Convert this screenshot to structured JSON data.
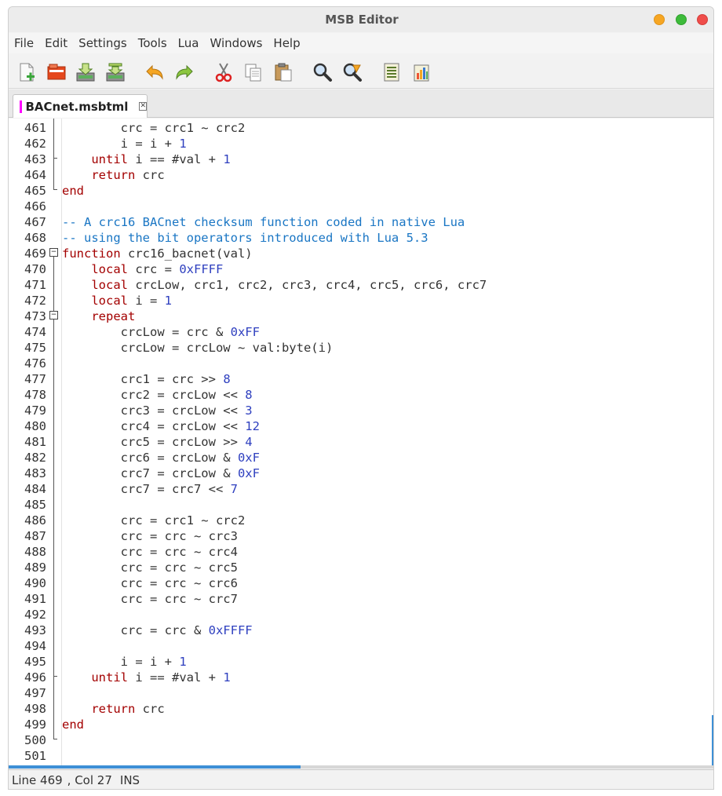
{
  "window": {
    "title": "MSB Editor"
  },
  "menu": {
    "items": [
      "File",
      "Edit",
      "Settings",
      "Tools",
      "Lua",
      "Windows",
      "Help"
    ]
  },
  "toolbar": {
    "icons": [
      "new-file-icon",
      "open-file-icon",
      "save-icon",
      "save-as-icon",
      "undo-icon",
      "redo-icon",
      "cut-icon",
      "copy-icon",
      "paste-icon",
      "find-icon",
      "replace-icon",
      "list-icon",
      "run-icon"
    ]
  },
  "tab": {
    "label": "BACnet.msbtml",
    "color": "#ff00ff"
  },
  "colors": {
    "keyword": "#a30000",
    "number": "#2e3fbf",
    "comment": "#1a76c4",
    "accent": "#3d8fd6"
  },
  "code": [
    {
      "num": "461",
      "t": [
        [
          "p",
          "        crc = crc1 ~ crc2"
        ]
      ]
    },
    {
      "num": "462",
      "t": [
        [
          "p",
          "        i = i + "
        ],
        [
          "n",
          "1"
        ]
      ]
    },
    {
      "num": "463",
      "t": [
        [
          "p",
          "    "
        ],
        [
          "k",
          "until"
        ],
        [
          "p",
          " i == #val + "
        ],
        [
          "n",
          "1"
        ]
      ]
    },
    {
      "num": "464",
      "t": [
        [
          "p",
          "    "
        ],
        [
          "k",
          "return"
        ],
        [
          "p",
          " crc"
        ]
      ]
    },
    {
      "num": "465",
      "t": [
        [
          "k",
          "end"
        ]
      ]
    },
    {
      "num": "466",
      "t": []
    },
    {
      "num": "467",
      "t": [
        [
          "c",
          "-- A crc16 BACnet checksum function coded in native Lua"
        ]
      ]
    },
    {
      "num": "468",
      "t": [
        [
          "c",
          "-- using the bit operators introduced with Lua 5.3"
        ]
      ]
    },
    {
      "num": "469",
      "t": [
        [
          "k",
          "function"
        ],
        [
          "p",
          " crc16_bacnet(val)"
        ]
      ]
    },
    {
      "num": "470",
      "t": [
        [
          "p",
          "    "
        ],
        [
          "k",
          "local"
        ],
        [
          "p",
          " crc = "
        ],
        [
          "n",
          "0xFFFF"
        ]
      ]
    },
    {
      "num": "471",
      "t": [
        [
          "p",
          "    "
        ],
        [
          "k",
          "local"
        ],
        [
          "p",
          " crcLow, crc1, crc2, crc3, crc4, crc5, crc6, crc7"
        ]
      ]
    },
    {
      "num": "472",
      "t": [
        [
          "p",
          "    "
        ],
        [
          "k",
          "local"
        ],
        [
          "p",
          " i = "
        ],
        [
          "n",
          "1"
        ]
      ]
    },
    {
      "num": "473",
      "t": [
        [
          "p",
          "    "
        ],
        [
          "k",
          "repeat"
        ]
      ]
    },
    {
      "num": "474",
      "t": [
        [
          "p",
          "        crcLow = crc & "
        ],
        [
          "n",
          "0xFF"
        ]
      ]
    },
    {
      "num": "475",
      "t": [
        [
          "p",
          "        crcLow = crcLow ~ val:byte(i)"
        ]
      ]
    },
    {
      "num": "476",
      "t": []
    },
    {
      "num": "477",
      "t": [
        [
          "p",
          "        crc1 = crc >> "
        ],
        [
          "n",
          "8"
        ]
      ]
    },
    {
      "num": "478",
      "t": [
        [
          "p",
          "        crc2 = crcLow << "
        ],
        [
          "n",
          "8"
        ]
      ]
    },
    {
      "num": "479",
      "t": [
        [
          "p",
          "        crc3 = crcLow << "
        ],
        [
          "n",
          "3"
        ]
      ]
    },
    {
      "num": "480",
      "t": [
        [
          "p",
          "        crc4 = crcLow << "
        ],
        [
          "n",
          "12"
        ]
      ]
    },
    {
      "num": "481",
      "t": [
        [
          "p",
          "        crc5 = crcLow >> "
        ],
        [
          "n",
          "4"
        ]
      ]
    },
    {
      "num": "482",
      "t": [
        [
          "p",
          "        crc6 = crcLow & "
        ],
        [
          "n",
          "0xF"
        ]
      ]
    },
    {
      "num": "483",
      "t": [
        [
          "p",
          "        crc7 = crcLow & "
        ],
        [
          "n",
          "0xF"
        ]
      ]
    },
    {
      "num": "484",
      "t": [
        [
          "p",
          "        crc7 = crc7 << "
        ],
        [
          "n",
          "7"
        ]
      ]
    },
    {
      "num": "485",
      "t": []
    },
    {
      "num": "486",
      "t": [
        [
          "p",
          "        crc = crc1 ~ crc2"
        ]
      ]
    },
    {
      "num": "487",
      "t": [
        [
          "p",
          "        crc = crc ~ crc3"
        ]
      ]
    },
    {
      "num": "488",
      "t": [
        [
          "p",
          "        crc = crc ~ crc4"
        ]
      ]
    },
    {
      "num": "489",
      "t": [
        [
          "p",
          "        crc = crc ~ crc5"
        ]
      ]
    },
    {
      "num": "490",
      "t": [
        [
          "p",
          "        crc = crc ~ crc6"
        ]
      ]
    },
    {
      "num": "491",
      "t": [
        [
          "p",
          "        crc = crc ~ crc7"
        ]
      ]
    },
    {
      "num": "492",
      "t": []
    },
    {
      "num": "493",
      "t": [
        [
          "p",
          "        crc = crc & "
        ],
        [
          "n",
          "0xFFFF"
        ]
      ]
    },
    {
      "num": "494",
      "t": []
    },
    {
      "num": "495",
      "t": [
        [
          "p",
          "        i = i + "
        ],
        [
          "n",
          "1"
        ]
      ]
    },
    {
      "num": "496",
      "t": [
        [
          "p",
          "    "
        ],
        [
          "k",
          "until"
        ],
        [
          "p",
          " i == #val + "
        ],
        [
          "n",
          "1"
        ]
      ]
    },
    {
      "num": "497",
      "t": []
    },
    {
      "num": "498",
      "t": [
        [
          "p",
          "    "
        ],
        [
          "k",
          "return"
        ],
        [
          "p",
          " crc"
        ]
      ]
    },
    {
      "num": "499",
      "t": [
        [
          "k",
          "end"
        ]
      ]
    },
    {
      "num": "500",
      "t": []
    },
    {
      "num": "501",
      "t": []
    }
  ],
  "status": {
    "line": "Line 469",
    "col": ", Col 27",
    "mode": "INS"
  }
}
